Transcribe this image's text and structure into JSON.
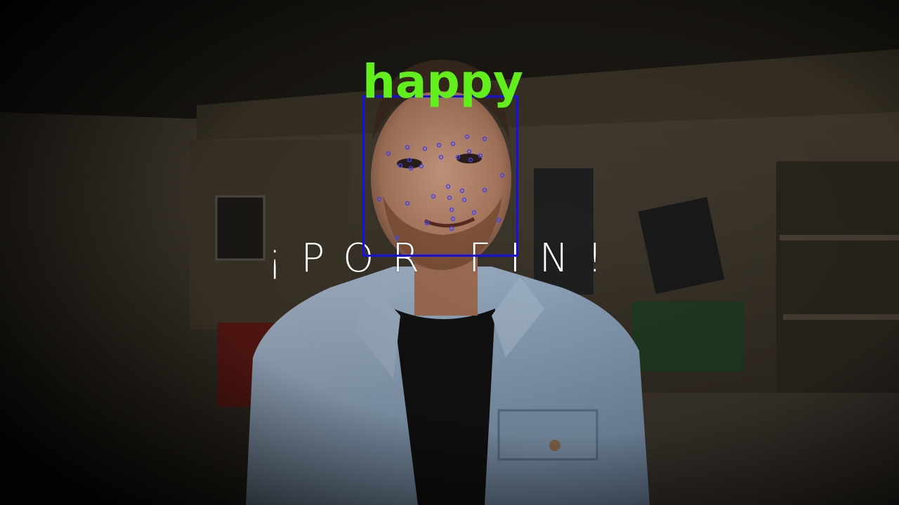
{
  "overlay": {
    "emotion_label": "happy",
    "caption": "¡POR FIN!",
    "colors": {
      "emotion_label": "#62ee1c",
      "face_box": "#1410e6",
      "landmarks": "#4b45ff",
      "caption": "#ffffff"
    }
  }
}
